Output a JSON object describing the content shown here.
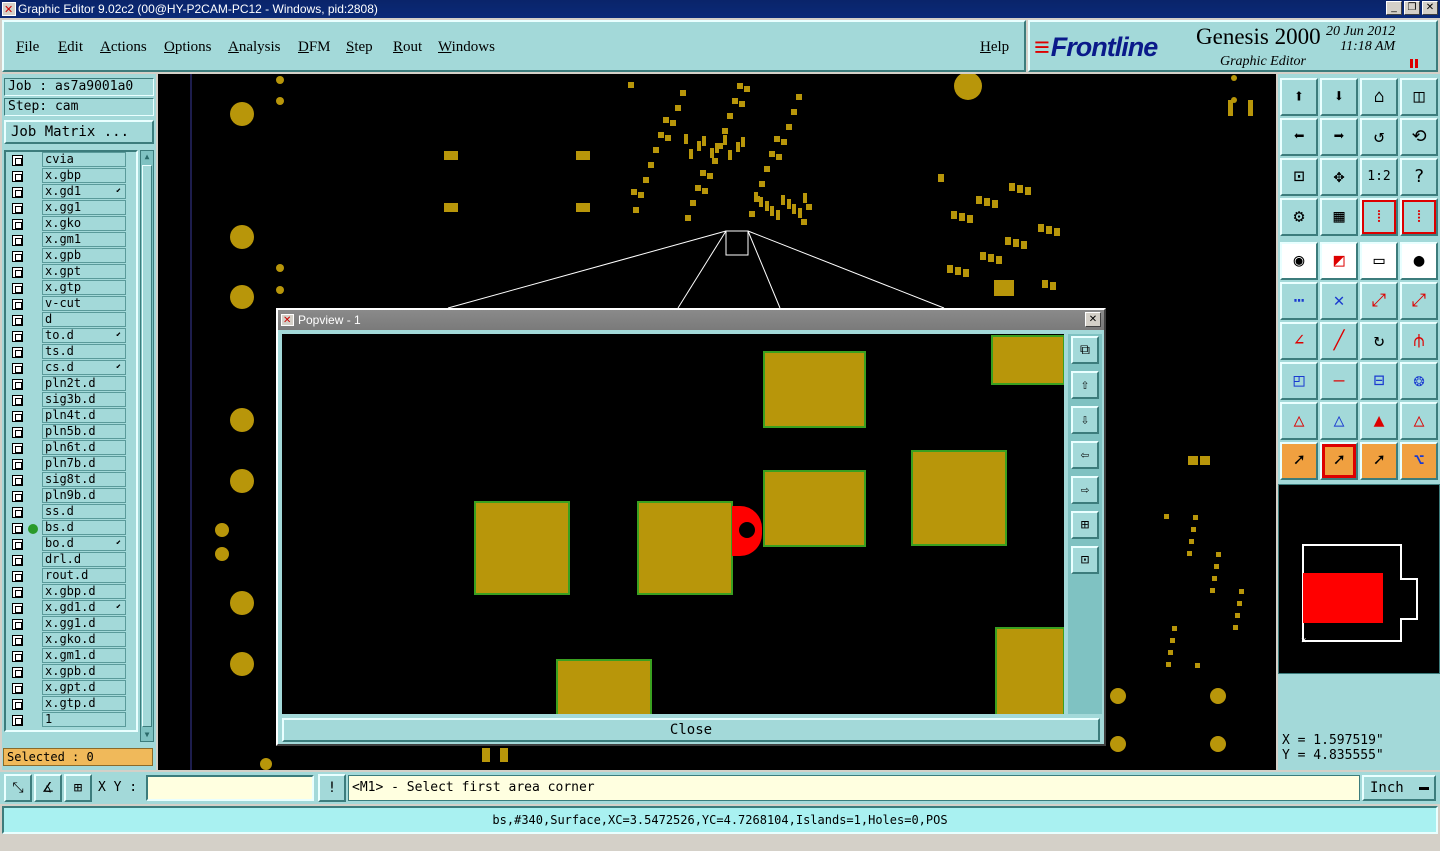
{
  "window": {
    "title": "Graphic Editor 9.02c2 (00@HY-P2CAM-PC12 - Windows, pid:2808)"
  },
  "menu": [
    "File",
    "Edit",
    "Actions",
    "Options",
    "Analysis",
    "DFM",
    "Step",
    "Rout",
    "Windows"
  ],
  "help_label": "Help",
  "brand": {
    "logo": "Frontline",
    "product": "Genesis 2000",
    "subtitle": "Graphic Editor",
    "date": "20 Jun 2012",
    "time": "11:18 AM"
  },
  "job": {
    "job_label": "Job : as7a9001a0",
    "step_label": "Step: cam",
    "matrix_button": "Job Matrix ..."
  },
  "layers": [
    {
      "name": "cvia"
    },
    {
      "name": "x.gbp"
    },
    {
      "name": "x.gd1",
      "mark": true
    },
    {
      "name": "x.gg1"
    },
    {
      "name": "x.gko"
    },
    {
      "name": "x.gm1"
    },
    {
      "name": "x.gpb"
    },
    {
      "name": "x.gpt"
    },
    {
      "name": "x.gtp"
    },
    {
      "name": "v-cut"
    },
    {
      "name": "d"
    },
    {
      "name": "to.d",
      "mark": true
    },
    {
      "name": "ts.d"
    },
    {
      "name": "cs.d",
      "mark": true
    },
    {
      "name": "pln2t.d"
    },
    {
      "name": "sig3b.d"
    },
    {
      "name": "pln4t.d"
    },
    {
      "name": "pln5b.d"
    },
    {
      "name": "pln6t.d"
    },
    {
      "name": "pln7b.d"
    },
    {
      "name": "sig8t.d"
    },
    {
      "name": "pln9b.d"
    },
    {
      "name": "ss.d"
    },
    {
      "name": "bs.d",
      "active": true
    },
    {
      "name": "bo.d",
      "mark": true
    },
    {
      "name": "drl.d"
    },
    {
      "name": "rout.d"
    },
    {
      "name": "x.gbp.d"
    },
    {
      "name": "x.gd1.d",
      "mark": true
    },
    {
      "name": "x.gg1.d"
    },
    {
      "name": "x.gko.d"
    },
    {
      "name": "x.gm1.d"
    },
    {
      "name": "x.gpb.d"
    },
    {
      "name": "x.gpt.d"
    },
    {
      "name": "x.gtp.d"
    },
    {
      "name": "1"
    }
  ],
  "selected_label": "Selected : 0",
  "popview": {
    "title": "Popview - 1",
    "close_label": "Close"
  },
  "coords": {
    "x": "X = 1.597519\"",
    "y": "Y = 4.835555\""
  },
  "command": {
    "xy_label": "X Y :",
    "xy_value": "",
    "prompt": "<M1> - Select first area corner",
    "units": "Inch"
  },
  "status": "bs,#340,Surface,XC=3.5472526,YC=4.7268104,Islands=1,Holes=0,POS",
  "colors": {
    "panel": "#a3d9d9",
    "pad": "#b8960a",
    "pad_outline": "#3aa020",
    "highlight": "#ff0000",
    "selected_bg": "#f0b95a"
  }
}
